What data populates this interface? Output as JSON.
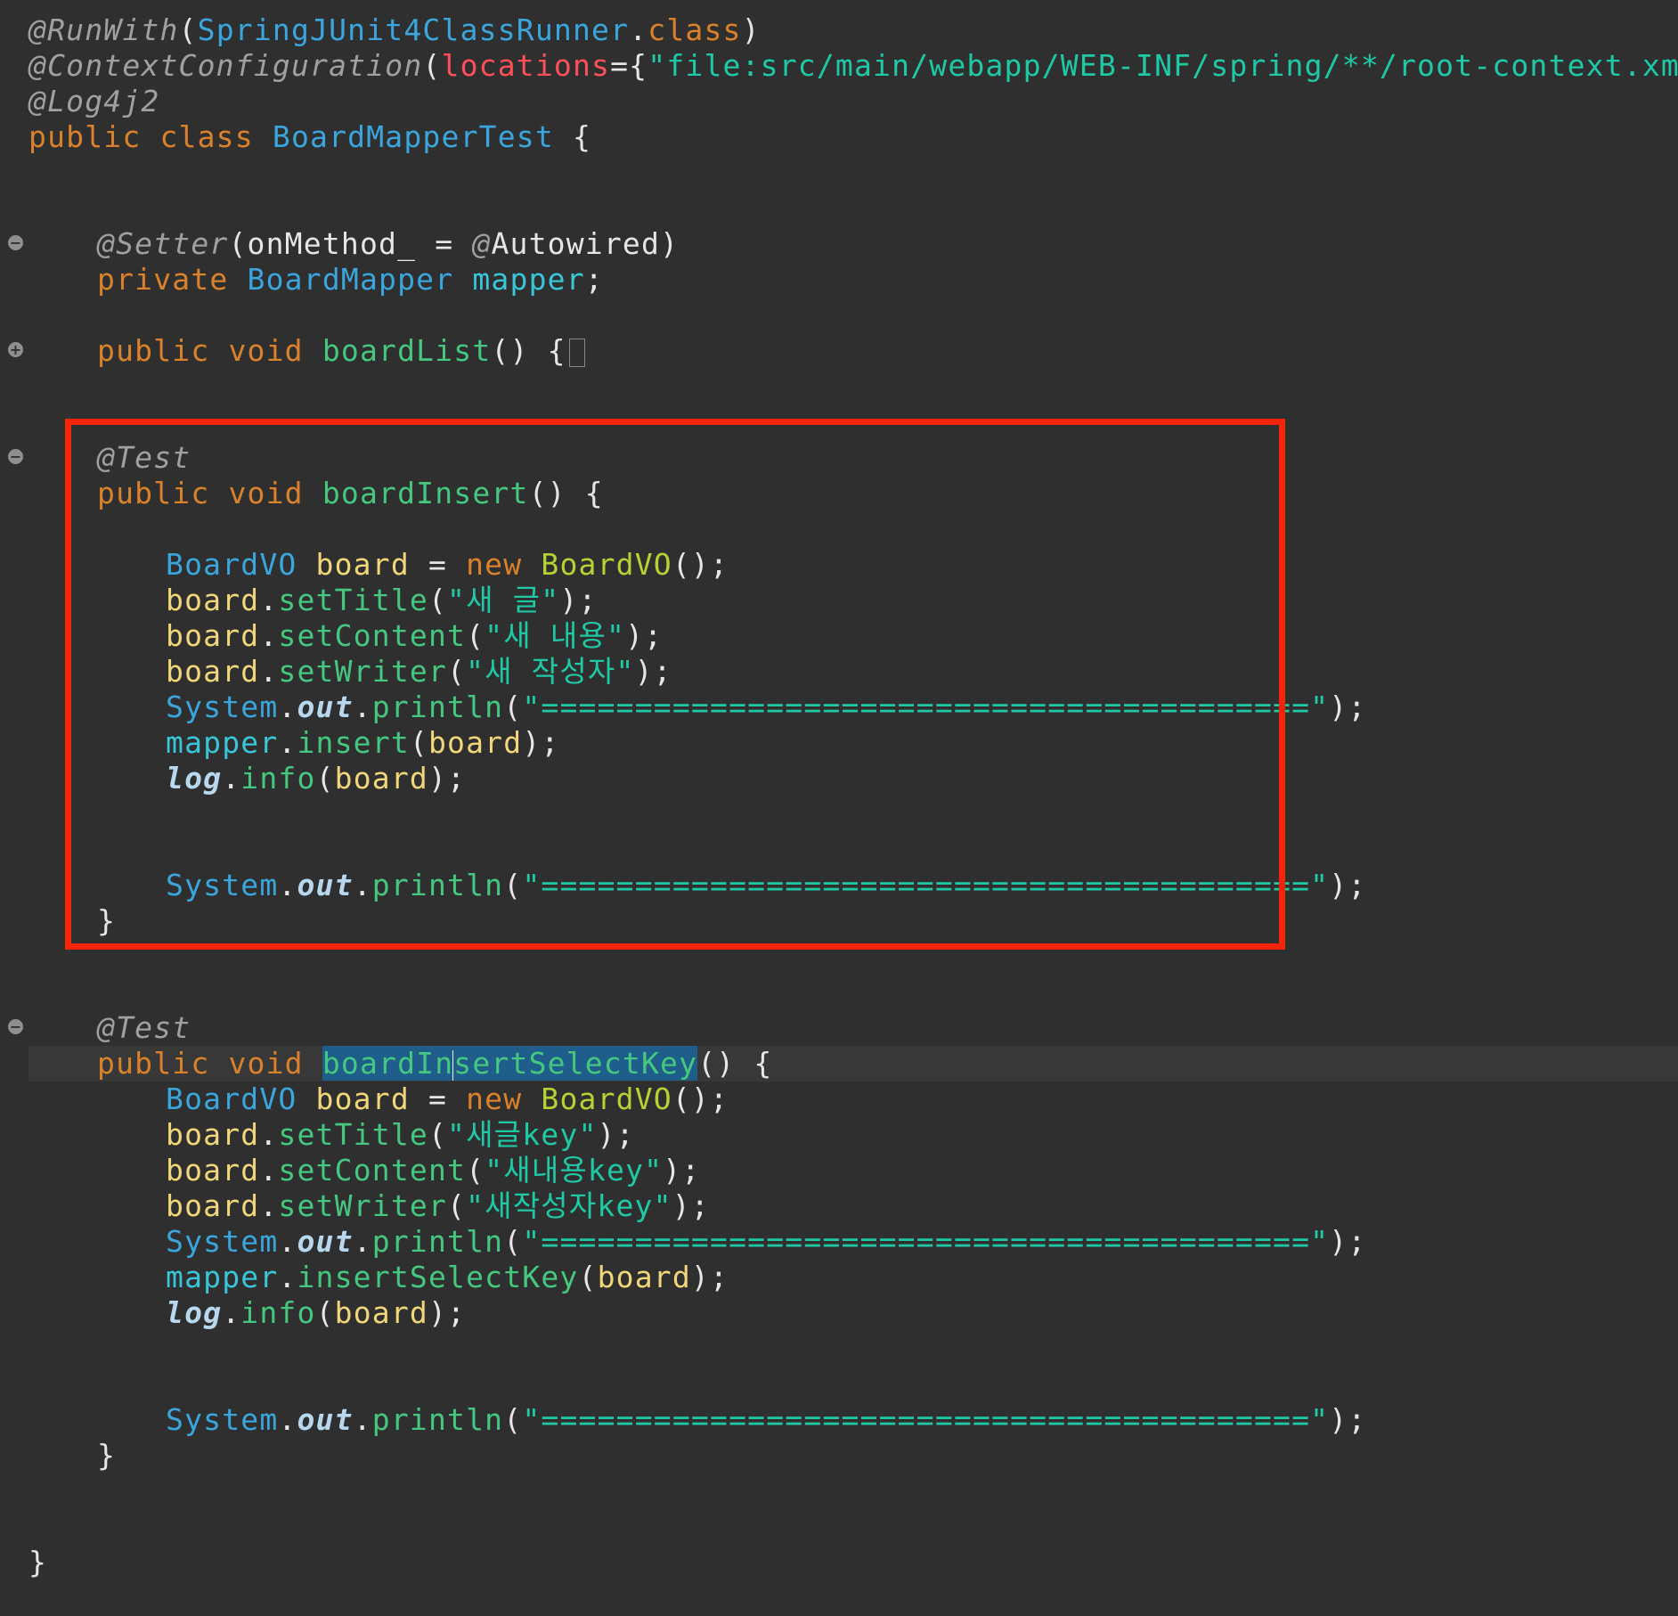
{
  "editor": {
    "line1": {
      "ann": "@RunWith",
      "p1": "(",
      "cls": "SpringJUnit4ClassRunner",
      "dot": ".",
      "kw": "class",
      "p2": ")"
    },
    "line2": {
      "ann": "@ContextConfiguration",
      "p1": "(",
      "param": "locations",
      "eq": "={",
      "str": "\"file:src/main/webapp/WEB-INF/spring/**/root-context.xml\"",
      "p2": "})"
    },
    "line3": {
      "ann": "@Log4j2"
    },
    "line4": {
      "kw": "public class ",
      "cls": "BoardMapperTest",
      "rest": " {"
    },
    "setter": {
      "ann": "@Setter",
      "p1": "(onMethod_ = ",
      "ann2": "@",
      "auto": "Autowired",
      "p2": ")"
    },
    "field": {
      "kw": "private ",
      "type": "BoardMapper",
      "var": " mapper",
      "rest": ";"
    },
    "boardList": {
      "kw": "public void ",
      "method": "boardList",
      "rest": "() {"
    },
    "insert": {
      "ann": "@Test",
      "sig": {
        "kw": "public void ",
        "method": "boardInsert",
        "rest": "() {"
      },
      "decl": {
        "type": "BoardVO",
        "var": " board",
        "eq": " = ",
        "kw": "new ",
        "cls": "BoardVO",
        "rest": "();"
      },
      "title": {
        "var": "board",
        "dot": ".",
        "method": "setTitle",
        "p1": "(",
        "str": "\"새 글\"",
        "p2": ");"
      },
      "content": {
        "var": "board",
        "dot": ".",
        "method": "setContent",
        "p1": "(",
        "str": "\"새 내용\"",
        "p2": ");"
      },
      "writer": {
        "var": "board",
        "dot": ".",
        "method": "setWriter",
        "p1": "(",
        "str": "\"새 작성자\"",
        "p2": ");"
      },
      "print": {
        "sys": "System",
        "dot": ".",
        "out": "out",
        "dot2": ".",
        "method": "println",
        "p1": "(",
        "str": "\"=========================================\"",
        "p2": ");"
      },
      "call": {
        "var": "mapper",
        "dot": ".",
        "method": "insert",
        "p1": "(",
        "arg": "board",
        "p2": ");"
      },
      "log": {
        "log": "log",
        "dot": ".",
        "method": "info",
        "p1": "(",
        "arg": "board",
        "p2": ");"
      },
      "close": "}"
    },
    "selectKey": {
      "ann": "@Test",
      "sig": {
        "kw": "public void ",
        "method_a": "boardIn",
        "method_b": "sertSelectKey",
        "rest": "() {"
      },
      "decl": {
        "type": "BoardVO",
        "var": " board",
        "eq": " = ",
        "kw": "new ",
        "cls": "BoardVO",
        "rest": "();"
      },
      "title": {
        "var": "board",
        "dot": ".",
        "method": "setTitle",
        "p1": "(",
        "str": "\"새글key\"",
        "p2": ");"
      },
      "content": {
        "var": "board",
        "dot": ".",
        "method": "setContent",
        "p1": "(",
        "str": "\"새내용key\"",
        "p2": ");"
      },
      "writer": {
        "var": "board",
        "dot": ".",
        "method": "setWriter",
        "p1": "(",
        "str": "\"새작성자key\"",
        "p2": ");"
      },
      "print": {
        "sys": "System",
        "dot": ".",
        "out": "out",
        "dot2": ".",
        "method": "println",
        "p1": "(",
        "str": "\"=========================================\"",
        "p2": ");"
      },
      "call": {
        "var": "mapper",
        "dot": ".",
        "method": "insertSelectKey",
        "p1": "(",
        "arg": "board",
        "p2": ");"
      },
      "log": {
        "log": "log",
        "dot": ".",
        "method": "info",
        "p1": "(",
        "arg": "board",
        "p2": ");"
      },
      "close": "}"
    },
    "classClose": "}",
    "fold": {
      "collapse": "−",
      "expand": "+"
    }
  },
  "colors": {
    "background": "#2f2f2f",
    "highlight_box": "#f5250c",
    "selection": "#1f5e8a"
  }
}
